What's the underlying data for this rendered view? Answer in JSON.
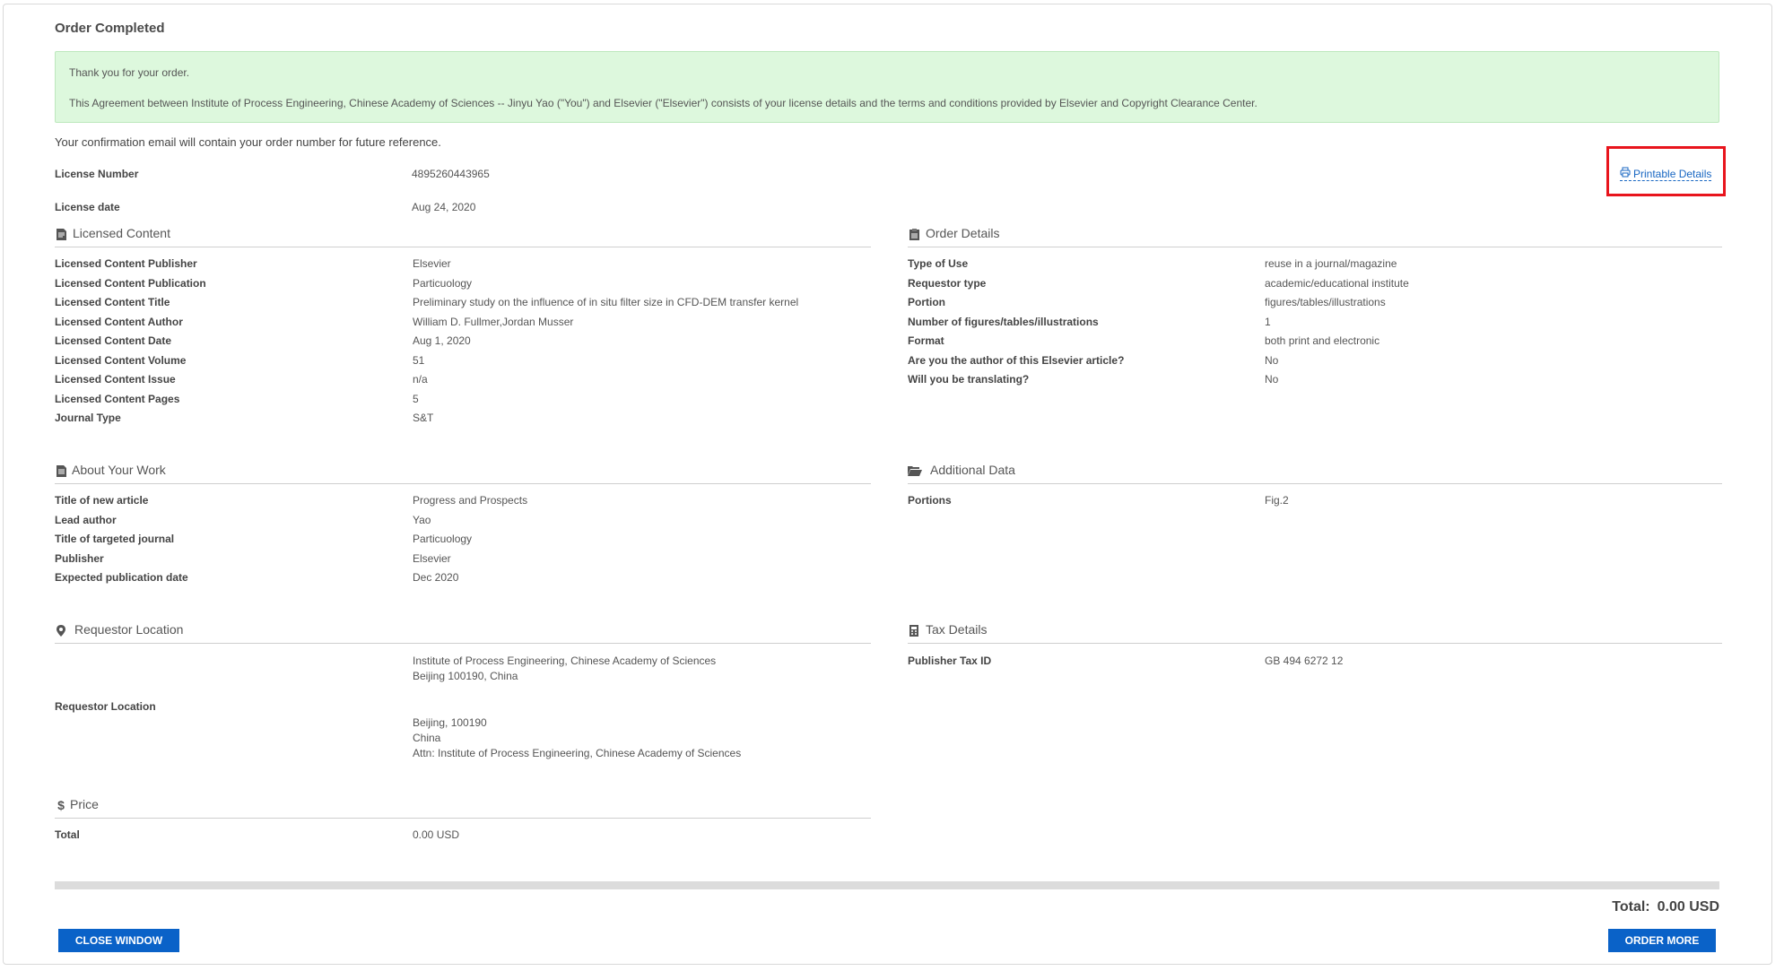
{
  "page_title": "Order Completed",
  "alert": {
    "thanks": "Thank you for your order.",
    "agreement": "This Agreement between Institute of Process Engineering, Chinese Academy of Sciences -- Jinyu Yao (\"You\") and Elsevier (\"Elsevier\") consists of your license details and the terms and conditions provided by Elsevier and Copyright Clearance Center."
  },
  "confirmation": "Your confirmation email will contain your order number for future reference.",
  "license": {
    "number_label": "License Number",
    "number_value": "4895260443965",
    "date_label": "License date",
    "date_value": "Aug 24, 2020"
  },
  "printable_label": "Printable Details",
  "licensed_content": {
    "title": "Licensed Content",
    "rows": [
      {
        "label": "Licensed Content Publisher",
        "value": "Elsevier"
      },
      {
        "label": "Licensed Content Publication",
        "value": "Particuology"
      },
      {
        "label": "Licensed Content Title",
        "value": "Preliminary study on the influence of in situ filter size in CFD-DEM transfer kernel"
      },
      {
        "label": "Licensed Content Author",
        "value": "William D. Fullmer,Jordan Musser"
      },
      {
        "label": "Licensed Content Date",
        "value": "Aug 1, 2020"
      },
      {
        "label": "Licensed Content Volume",
        "value": "51"
      },
      {
        "label": "Licensed Content Issue",
        "value": "n/a"
      },
      {
        "label": "Licensed Content Pages",
        "value": "5"
      },
      {
        "label": "Journal Type",
        "value": "S&T"
      }
    ]
  },
  "order_details": {
    "title": "Order Details",
    "rows": [
      {
        "label": "Type of Use",
        "value": "reuse in a journal/magazine"
      },
      {
        "label": "Requestor type",
        "value": "academic/educational institute"
      },
      {
        "label": "Portion",
        "value": "figures/tables/illustrations"
      },
      {
        "label": "Number of figures/tables/illustrations",
        "value": "1"
      },
      {
        "label": "Format",
        "value": "both print and electronic"
      },
      {
        "label": "Are you the author of this Elsevier article?",
        "value": "No"
      },
      {
        "label": "Will you be translating?",
        "value": "No"
      }
    ]
  },
  "about_work": {
    "title": "About Your Work",
    "rows": [
      {
        "label": "Title of new article",
        "value": "Progress and Prospects"
      },
      {
        "label": "Lead author",
        "value": "Yao"
      },
      {
        "label": "Title of targeted journal",
        "value": "Particuology"
      },
      {
        "label": "Publisher",
        "value": "Elsevier"
      },
      {
        "label": "Expected publication date",
        "value": "Dec 2020"
      }
    ]
  },
  "additional_data": {
    "title": "Additional Data",
    "rows": [
      {
        "label": "Portions",
        "value": "Fig.2"
      }
    ]
  },
  "requestor_location": {
    "title": "Requestor Location",
    "label": "Requestor Location",
    "lines": [
      "Institute of Process Engineering, Chinese Academy of Sciences",
      "Beijing 100190, China",
      "Beijing, 100190",
      "China",
      "Attn: Institute of Process Engineering, Chinese Academy of Sciences"
    ]
  },
  "tax_details": {
    "title": "Tax Details",
    "rows": [
      {
        "label": "Publisher Tax ID",
        "value": "GB 494 6272 12"
      }
    ]
  },
  "price": {
    "title": "Price",
    "rows": [
      {
        "label": "Total",
        "value": "0.00 USD"
      }
    ]
  },
  "footer": {
    "total_label": "Total:",
    "total_value": "0.00 USD",
    "close_button": "CLOSE WINDOW",
    "order_more_button": "ORDER MORE"
  },
  "colors": {
    "accent": "#0a62c8",
    "alert_bg": "#ddf8dd",
    "highlight_border": "#e8141c"
  }
}
